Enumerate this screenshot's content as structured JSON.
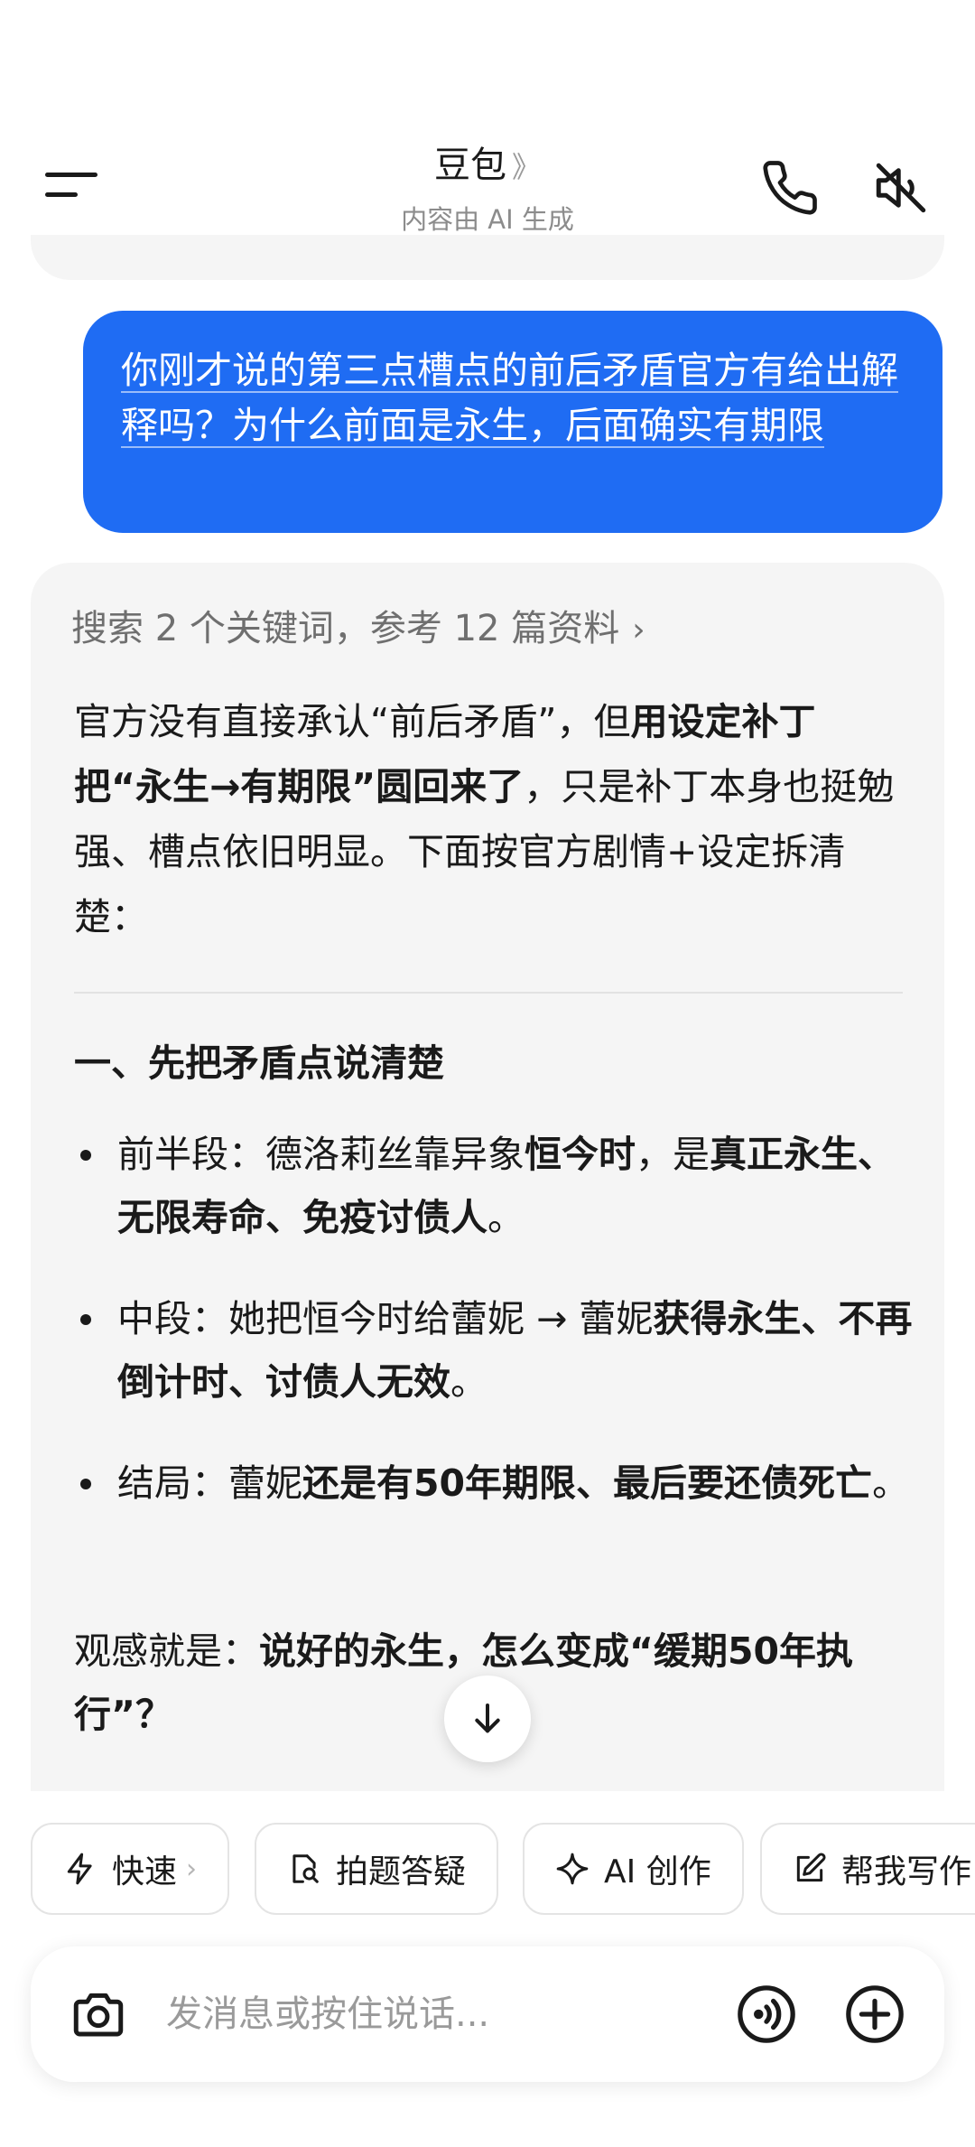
{
  "header": {
    "title": "豆包",
    "title_chevron": "》",
    "subtitle": "内容由 AI 生成",
    "icons": [
      "menu-icon",
      "phone-icon",
      "speaker-mute-icon"
    ]
  },
  "user_message": "你刚才说的第三点槽点的前后矛盾官方有给出解释吗？为什么前面是永生，后面确实有期限",
  "ai_message": {
    "search_summary": "搜索 2 个关键词，参考 12 篇资料",
    "search_chevron": "›",
    "intro": {
      "p1": "官方没有直接承认“前后矛盾”，但",
      "p2": "用设定补丁把“永生→有期限”圆回来了",
      "p3": "，只是补丁本身也挺勉强、槽点依旧明显。下面按官方剧情+设定拆清楚："
    },
    "section_heading": "一、先把矛盾点说清楚",
    "bullets": [
      {
        "a": "前半段：德洛莉丝靠异象",
        "b": "恒今时",
        "c": "，是",
        "d": "真正永生、无限寿命、免疫讨债人",
        "e": "。"
      },
      {
        "a": "中段：她把恒今时给蕾妮 → 蕾妮",
        "b": "获得永生、不再倒计时、讨债人无效",
        "c": "。"
      },
      {
        "a": "结局：蕾妮",
        "b": "还是有50年期限、最后要还债死亡",
        "c": "。"
      }
    ],
    "summary": {
      "a": "观感就是：",
      "b": "说好的永生，怎么变成“缓期50年执行”？"
    }
  },
  "quick_actions": [
    {
      "label": "快速",
      "icon": "lightning-icon",
      "chevron": "›"
    },
    {
      "label": "拍题答疑",
      "icon": "photo-question-icon"
    },
    {
      "label": "AI 创作",
      "icon": "sparkle-icon"
    },
    {
      "label": "帮我写作",
      "icon": "edit-icon"
    }
  ],
  "input": {
    "placeholder": "发消息或按住说话..."
  },
  "colors": {
    "user_bubble": "#1f6cf3",
    "ai_card_bg": "#f5f5f5"
  }
}
